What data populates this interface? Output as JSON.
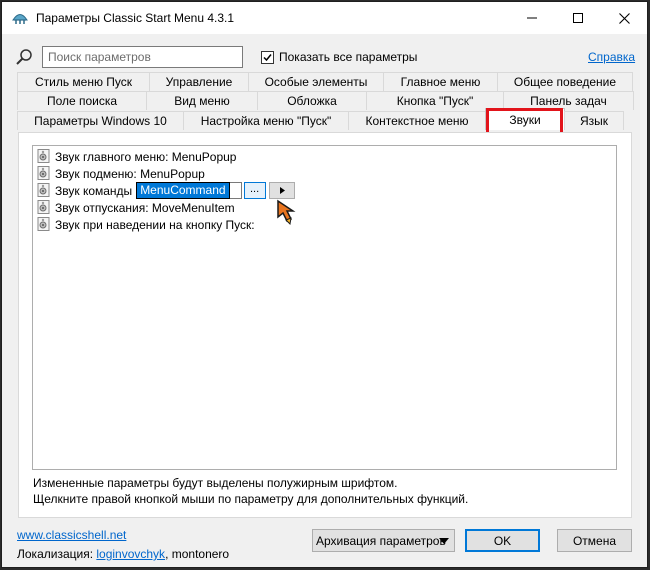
{
  "window": {
    "title": "Параметры Classic Start Menu 4.3.1"
  },
  "toolbar": {
    "search_placeholder": "Поиск параметров",
    "show_all_label": "Показать все параметры",
    "show_all_checked": true,
    "help_label": "Справка"
  },
  "tabs": {
    "row1": [
      "Стиль меню Пуск",
      "Управление",
      "Особые элементы",
      "Главное меню",
      "Общее поведение"
    ],
    "row2": [
      "Поле поиска",
      "Вид меню",
      "Обложка",
      "Кнопка \"Пуск\"",
      "Панель задач"
    ],
    "row3": [
      "Параметры Windows 10",
      "Настройка меню \"Пуск\"",
      "Контекстное меню",
      "Звуки",
      "Язык"
    ],
    "active": "Звуки"
  },
  "sounds": {
    "items": [
      {
        "label": "Звук главного меню: MenuPopup"
      },
      {
        "label": "Звук подменю: MenuPopup"
      },
      {
        "label": "Звук команды",
        "edit_value": "MenuCommand",
        "browse_label": "..."
      },
      {
        "label": "Звук отпускания: MoveMenuItem"
      },
      {
        "label": "Звук при наведении на кнопку Пуск:"
      }
    ]
  },
  "hints": {
    "line1": "Измененные параметры будут выделены полужирным шрифтом.",
    "line2": "Щелкните правой кнопкой мыши по параметру для дополнительных функций."
  },
  "footer": {
    "site_link": "www.classicshell.net",
    "localization_prefix": "Локализация: ",
    "localization_author": "loginvovchyk",
    "localization_rest": ", montonero",
    "backup_label": "Архивация параметров",
    "ok_label": "OK",
    "cancel_label": "Отмена"
  },
  "colors": {
    "accent": "#0078d7",
    "highlight_box": "#e2141b",
    "link": "#0066cc"
  }
}
